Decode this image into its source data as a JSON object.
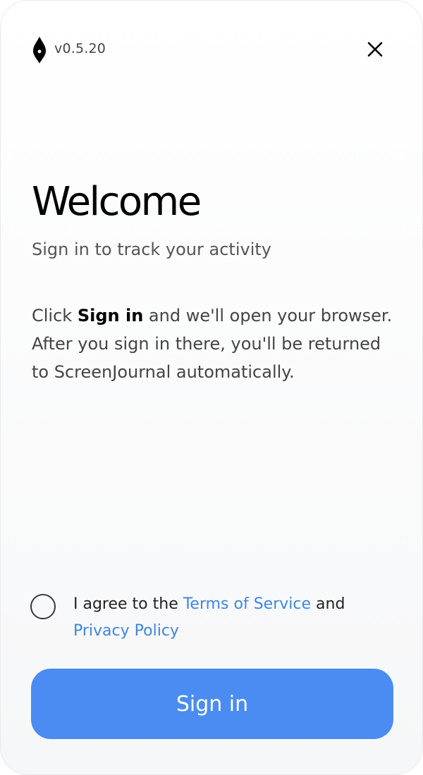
{
  "header": {
    "version": "v0.5.20",
    "logo_icon": "pen-nib-icon",
    "close_icon": "close-icon"
  },
  "main": {
    "title": "Welcome",
    "subtitle": "Sign in to track your activity",
    "description": {
      "prefix": "Click ",
      "emphasis": "Sign in",
      "suffix": " and we'll open your browser. After you sign in there, you'll be returned to ScreenJournal automatically."
    }
  },
  "agreement": {
    "checked": false,
    "text_prefix": "I agree to the ",
    "terms_link": "Terms of Service",
    "text_middle": " and ",
    "privacy_link": "Privacy Policy"
  },
  "actions": {
    "signin_label": "Sign in"
  },
  "colors": {
    "accent": "#4a8cf2",
    "link": "#3d86e6",
    "title": "#000000",
    "body_text": "#444444"
  }
}
